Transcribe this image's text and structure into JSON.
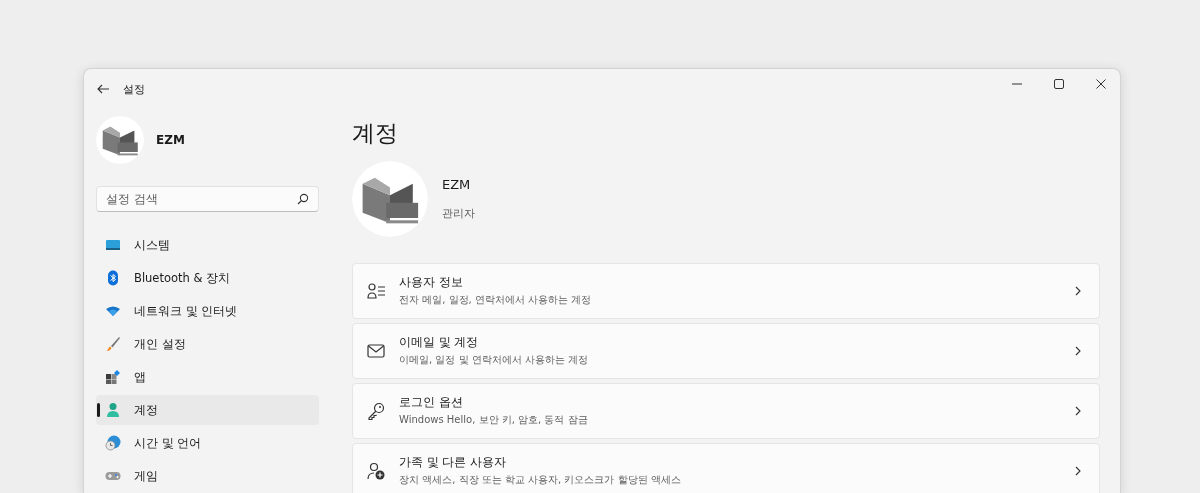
{
  "window": {
    "title": "설정"
  },
  "user": {
    "name": "EZM"
  },
  "search": {
    "placeholder": "설정 검색"
  },
  "nav": [
    {
      "label": "시스템",
      "kind": "system",
      "selected": false
    },
    {
      "label": "Bluetooth & 장치",
      "kind": "bluetooth",
      "selected": false
    },
    {
      "label": "네트워크 및 인터넷",
      "kind": "network",
      "selected": false
    },
    {
      "label": "개인 설정",
      "kind": "brush",
      "selected": false
    },
    {
      "label": "앱",
      "kind": "apps",
      "selected": false
    },
    {
      "label": "계정",
      "kind": "account",
      "selected": true
    },
    {
      "label": "시간 및 언어",
      "kind": "time",
      "selected": false
    },
    {
      "label": "게임",
      "kind": "game",
      "selected": false
    }
  ],
  "page": {
    "title": "계정",
    "profile": {
      "name": "EZM",
      "role": "관리자"
    },
    "cards": [
      {
        "kind": "person-list",
        "title": "사용자 정보",
        "subtitle": "전자 메일, 일정, 연락처에서 사용하는 계정"
      },
      {
        "kind": "mail",
        "title": "이메일 및 계정",
        "subtitle": "이메일, 일정 및 연락처에서 사용하는 계정"
      },
      {
        "kind": "key",
        "title": "로그인 옵션",
        "subtitle": "Windows Hello, 보안 키, 암호, 동적 잠금"
      },
      {
        "kind": "person-add",
        "title": "가족 및 다른 사용자",
        "subtitle": "장치 액세스, 직장 또는 학교 사용자, 키오스크가 할당된 액세스"
      }
    ]
  }
}
